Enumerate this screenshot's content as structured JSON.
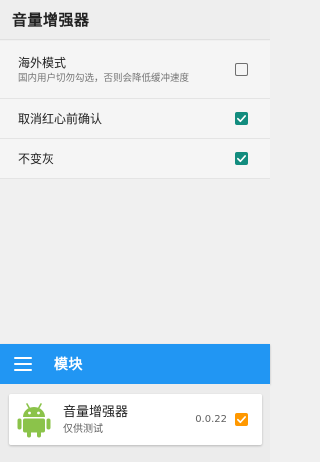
{
  "appbar": {
    "title": "音量增强器"
  },
  "settings": [
    {
      "title": "海外模式",
      "summary": "国内用户切勿勾选，否则会降低缓冲速度",
      "checked": false
    },
    {
      "title": "取消红心前确认",
      "checked": true
    },
    {
      "title": "不变灰",
      "checked": true
    }
  ],
  "module_bar": {
    "title": "模块",
    "menu_icon": "menu-icon"
  },
  "module": {
    "name": "音量增强器",
    "description": "仅供测试",
    "version": "0.0.22",
    "enabled": true,
    "icon": "android-icon"
  },
  "colors": {
    "accent_blue": "#2196f3",
    "checkbox_teal": "#128c7e",
    "checkbox_orange": "#ff9800"
  }
}
